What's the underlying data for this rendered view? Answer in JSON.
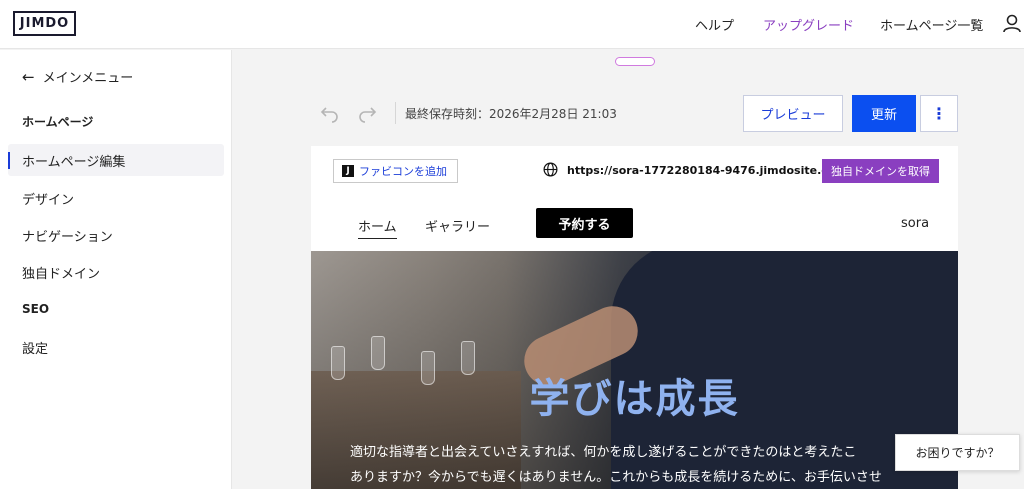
{
  "header": {
    "logo": "JIMDO",
    "nav": [
      "ヘルプ",
      "アップグレード",
      "ホームページ一覧"
    ],
    "accent_color": "#8a3fc0"
  },
  "sidebar": {
    "back_label": "メインメニュー",
    "section_homepage": "ホームページ",
    "items": [
      {
        "label": "ホームページ編集",
        "active": true
      },
      {
        "label": "デザイン"
      },
      {
        "label": "ナビゲーション"
      },
      {
        "label": "独自ドメイン"
      }
    ],
    "section_seo": "SEO",
    "settings_label": "設定"
  },
  "toolbar": {
    "save_time": "最終保存時刻：2026年2月28日 21:03",
    "preview_label": "プレビュー",
    "update_label": "更新",
    "more_label": "⋮"
  },
  "site": {
    "favicon_label": "ファビコンを追加",
    "url": "https://sora-1772280184-9476.jimdosite.com",
    "domain_button": "独自ドメインを取得",
    "nav": [
      "ホーム",
      "ギャラリー"
    ],
    "reserve_label": "予約する",
    "site_name": "sora",
    "hero_title": "学びは成長",
    "hero_line1": "適切な指導者と出会えていさえすれば、何かを成し遂げることができたのはと考えたこ",
    "hero_line2": "ありますか？今からでも遅くはありません。これからも成長を続けるために、お手伝いさせ"
  },
  "help_bubble": "お困りですか？",
  "colors": {
    "primary_blue": "#0b4ff0",
    "purple": "#8a3fc0",
    "hero_title": "#8fb2ef"
  }
}
